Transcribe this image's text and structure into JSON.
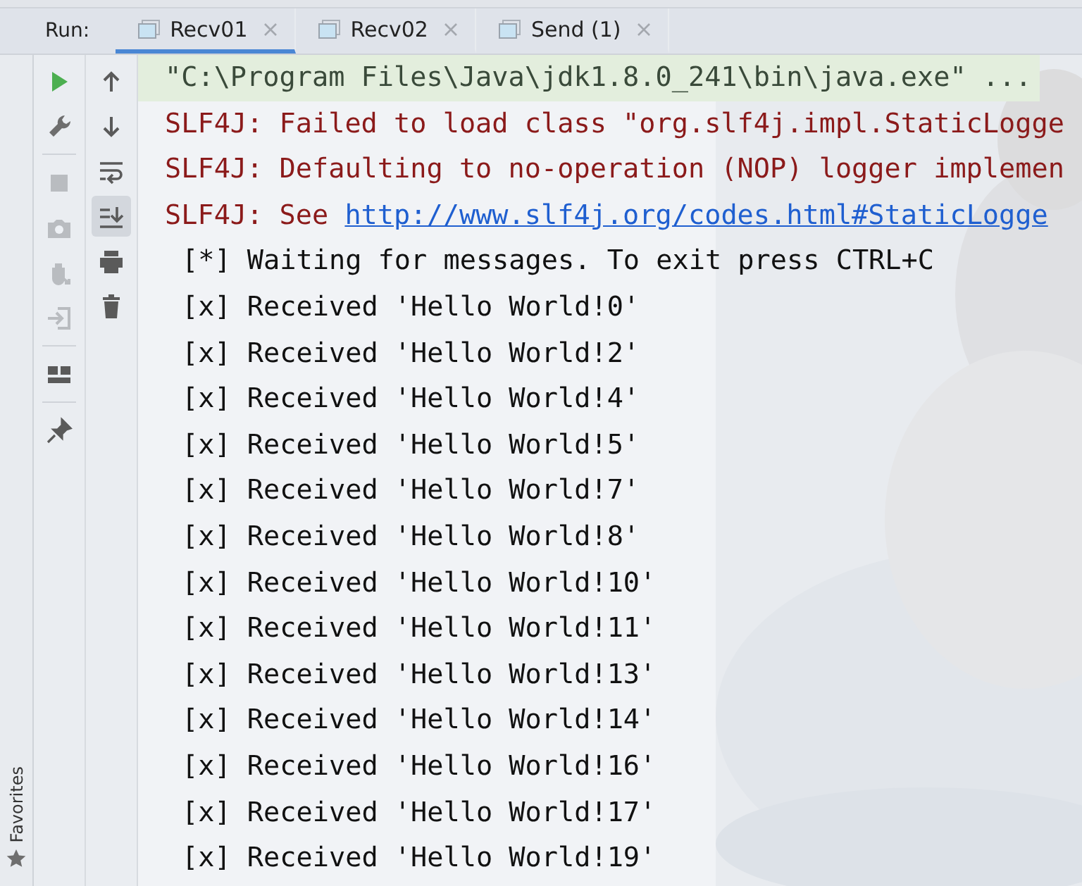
{
  "run_label": "Run:",
  "tabs": [
    {
      "label": "Recv01",
      "selected": true
    },
    {
      "label": "Recv02",
      "selected": false
    },
    {
      "label": "Send (1)",
      "selected": false
    }
  ],
  "toolbar_left": [
    {
      "disabled": false
    },
    {
      "disabled": false
    },
    {
      "disabled": true
    },
    {
      "disabled": true
    },
    {
      "disabled": true
    },
    {
      "disabled": true
    },
    {
      "disabled": false
    },
    {
      "disabled": false
    }
  ],
  "toolbar_right": [
    {
      "selected": false
    },
    {
      "selected": false
    },
    {
      "selected": false
    },
    {
      "selected": true
    },
    {
      "selected": false
    },
    {
      "selected": false
    }
  ],
  "favorites": "Favorites",
  "console": [
    {
      "kind": "command",
      "text": "\"C:\\Program Files\\Java\\jdk1.8.0_241\\bin\\java.exe\" ..."
    },
    {
      "kind": "error",
      "text": "SLF4J: Failed to load class \"org.slf4j.impl.StaticLogge"
    },
    {
      "kind": "error",
      "text": "SLF4J: Defaulting to no-operation (NOP) logger implemen"
    },
    {
      "kind": "error",
      "text": "SLF4J: See ",
      "link": "http://www.slf4j.org/codes.html#StaticLogge"
    },
    {
      "kind": "output",
      "text": "[*] Waiting for messages. To exit press CTRL+C"
    },
    {
      "kind": "output",
      "text": "[x] Received 'Hello World!0'"
    },
    {
      "kind": "output",
      "text": "[x] Received 'Hello World!2'"
    },
    {
      "kind": "output",
      "text": "[x] Received 'Hello World!4'"
    },
    {
      "kind": "output",
      "text": "[x] Received 'Hello World!5'"
    },
    {
      "kind": "output",
      "text": "[x] Received 'Hello World!7'"
    },
    {
      "kind": "output",
      "text": "[x] Received 'Hello World!8'"
    },
    {
      "kind": "output",
      "text": "[x] Received 'Hello World!10'"
    },
    {
      "kind": "output",
      "text": "[x] Received 'Hello World!11'"
    },
    {
      "kind": "output",
      "text": "[x] Received 'Hello World!13'"
    },
    {
      "kind": "output",
      "text": "[x] Received 'Hello World!14'"
    },
    {
      "kind": "output",
      "text": "[x] Received 'Hello World!16'"
    },
    {
      "kind": "output",
      "text": "[x] Received 'Hello World!17'"
    },
    {
      "kind": "output",
      "text": "[x] Received 'Hello World!19'"
    }
  ]
}
